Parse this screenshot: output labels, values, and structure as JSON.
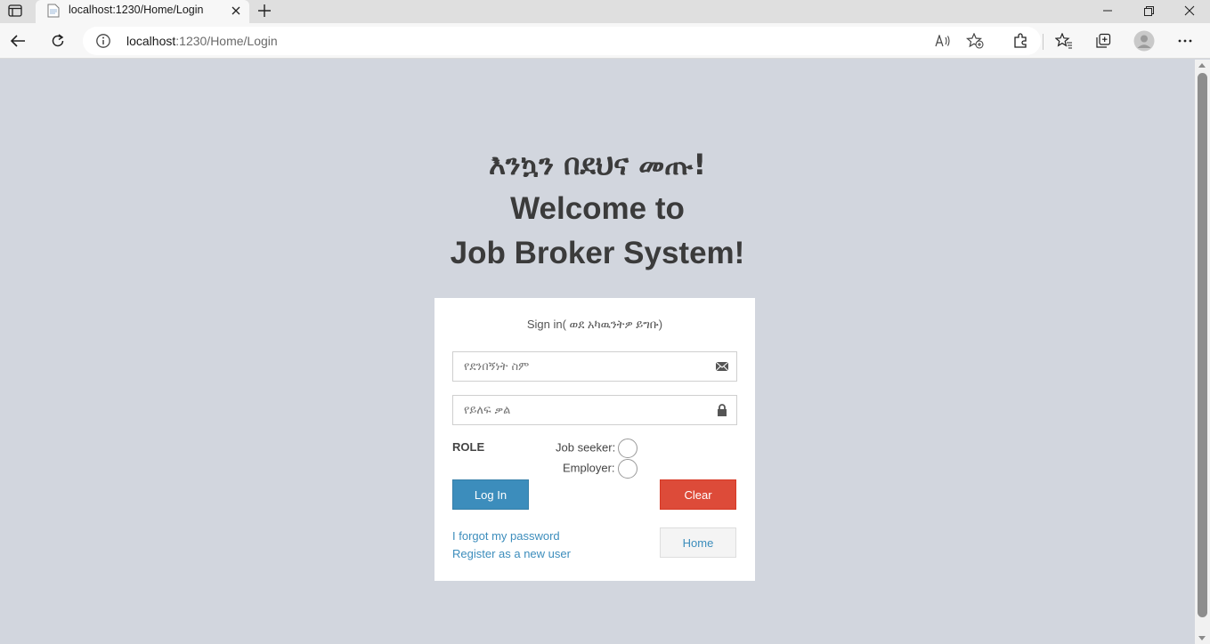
{
  "browser": {
    "tab_title": "localhost:1230/Home/Login",
    "url_host": "localhost",
    "url_path": ":1230/Home/Login"
  },
  "page": {
    "heading_amharic": "እንኳን በደህና መጡ!",
    "heading_line1": "Welcome to",
    "heading_line2": "Job Broker System!",
    "signin_message": "Sign in( ወደ አካዉንትዎ ይግቡ)",
    "username_placeholder": "የደንበኝነት ስም",
    "password_placeholder": "የይለፍ ቃል",
    "role_label": "ROLE",
    "role_options": [
      "Job seeker:",
      "Employer:"
    ],
    "login_button": "Log In",
    "clear_button": "Clear",
    "home_button": "Home",
    "forgot_link": "I forgot my password",
    "register_link": "Register as a new user"
  },
  "colors": {
    "page_background": "#d2d6de",
    "primary": "#3c8dbc",
    "danger": "#dd4b39"
  }
}
